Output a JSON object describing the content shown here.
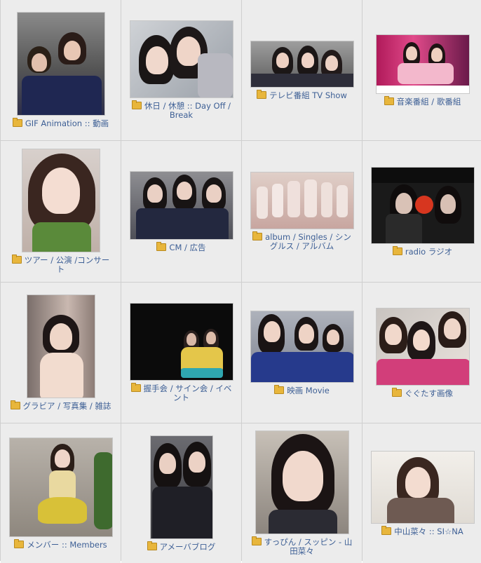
{
  "gallery": {
    "items": [
      {
        "label": "GIF Animation :: 動画"
      },
      {
        "label": "休日 / 休憩 :: Day Off / Break"
      },
      {
        "label": "テレビ番組 TV Show"
      },
      {
        "label": "音楽番組 / 歌番組"
      },
      {
        "label": "ツアー / 公演 /コンサート"
      },
      {
        "label": "CM / 広告"
      },
      {
        "label": "album / Singles / シングルス / アルバム"
      },
      {
        "label": "radio ラジオ"
      },
      {
        "label": "グラビア / 写真集 / 雑誌"
      },
      {
        "label": "握手会 / サイン会 / イベント"
      },
      {
        "label": "映画 Movie"
      },
      {
        "label": "ぐぐたす画像"
      },
      {
        "label": "メンバー :: Members"
      },
      {
        "label": "アメーバブログ"
      },
      {
        "label": "すっぴん / スッピン - 山田菜々"
      },
      {
        "label": "中山菜々 :: SI☆NA"
      }
    ],
    "folder_icon": "folder-icon",
    "link_color": "#3d5f95"
  }
}
